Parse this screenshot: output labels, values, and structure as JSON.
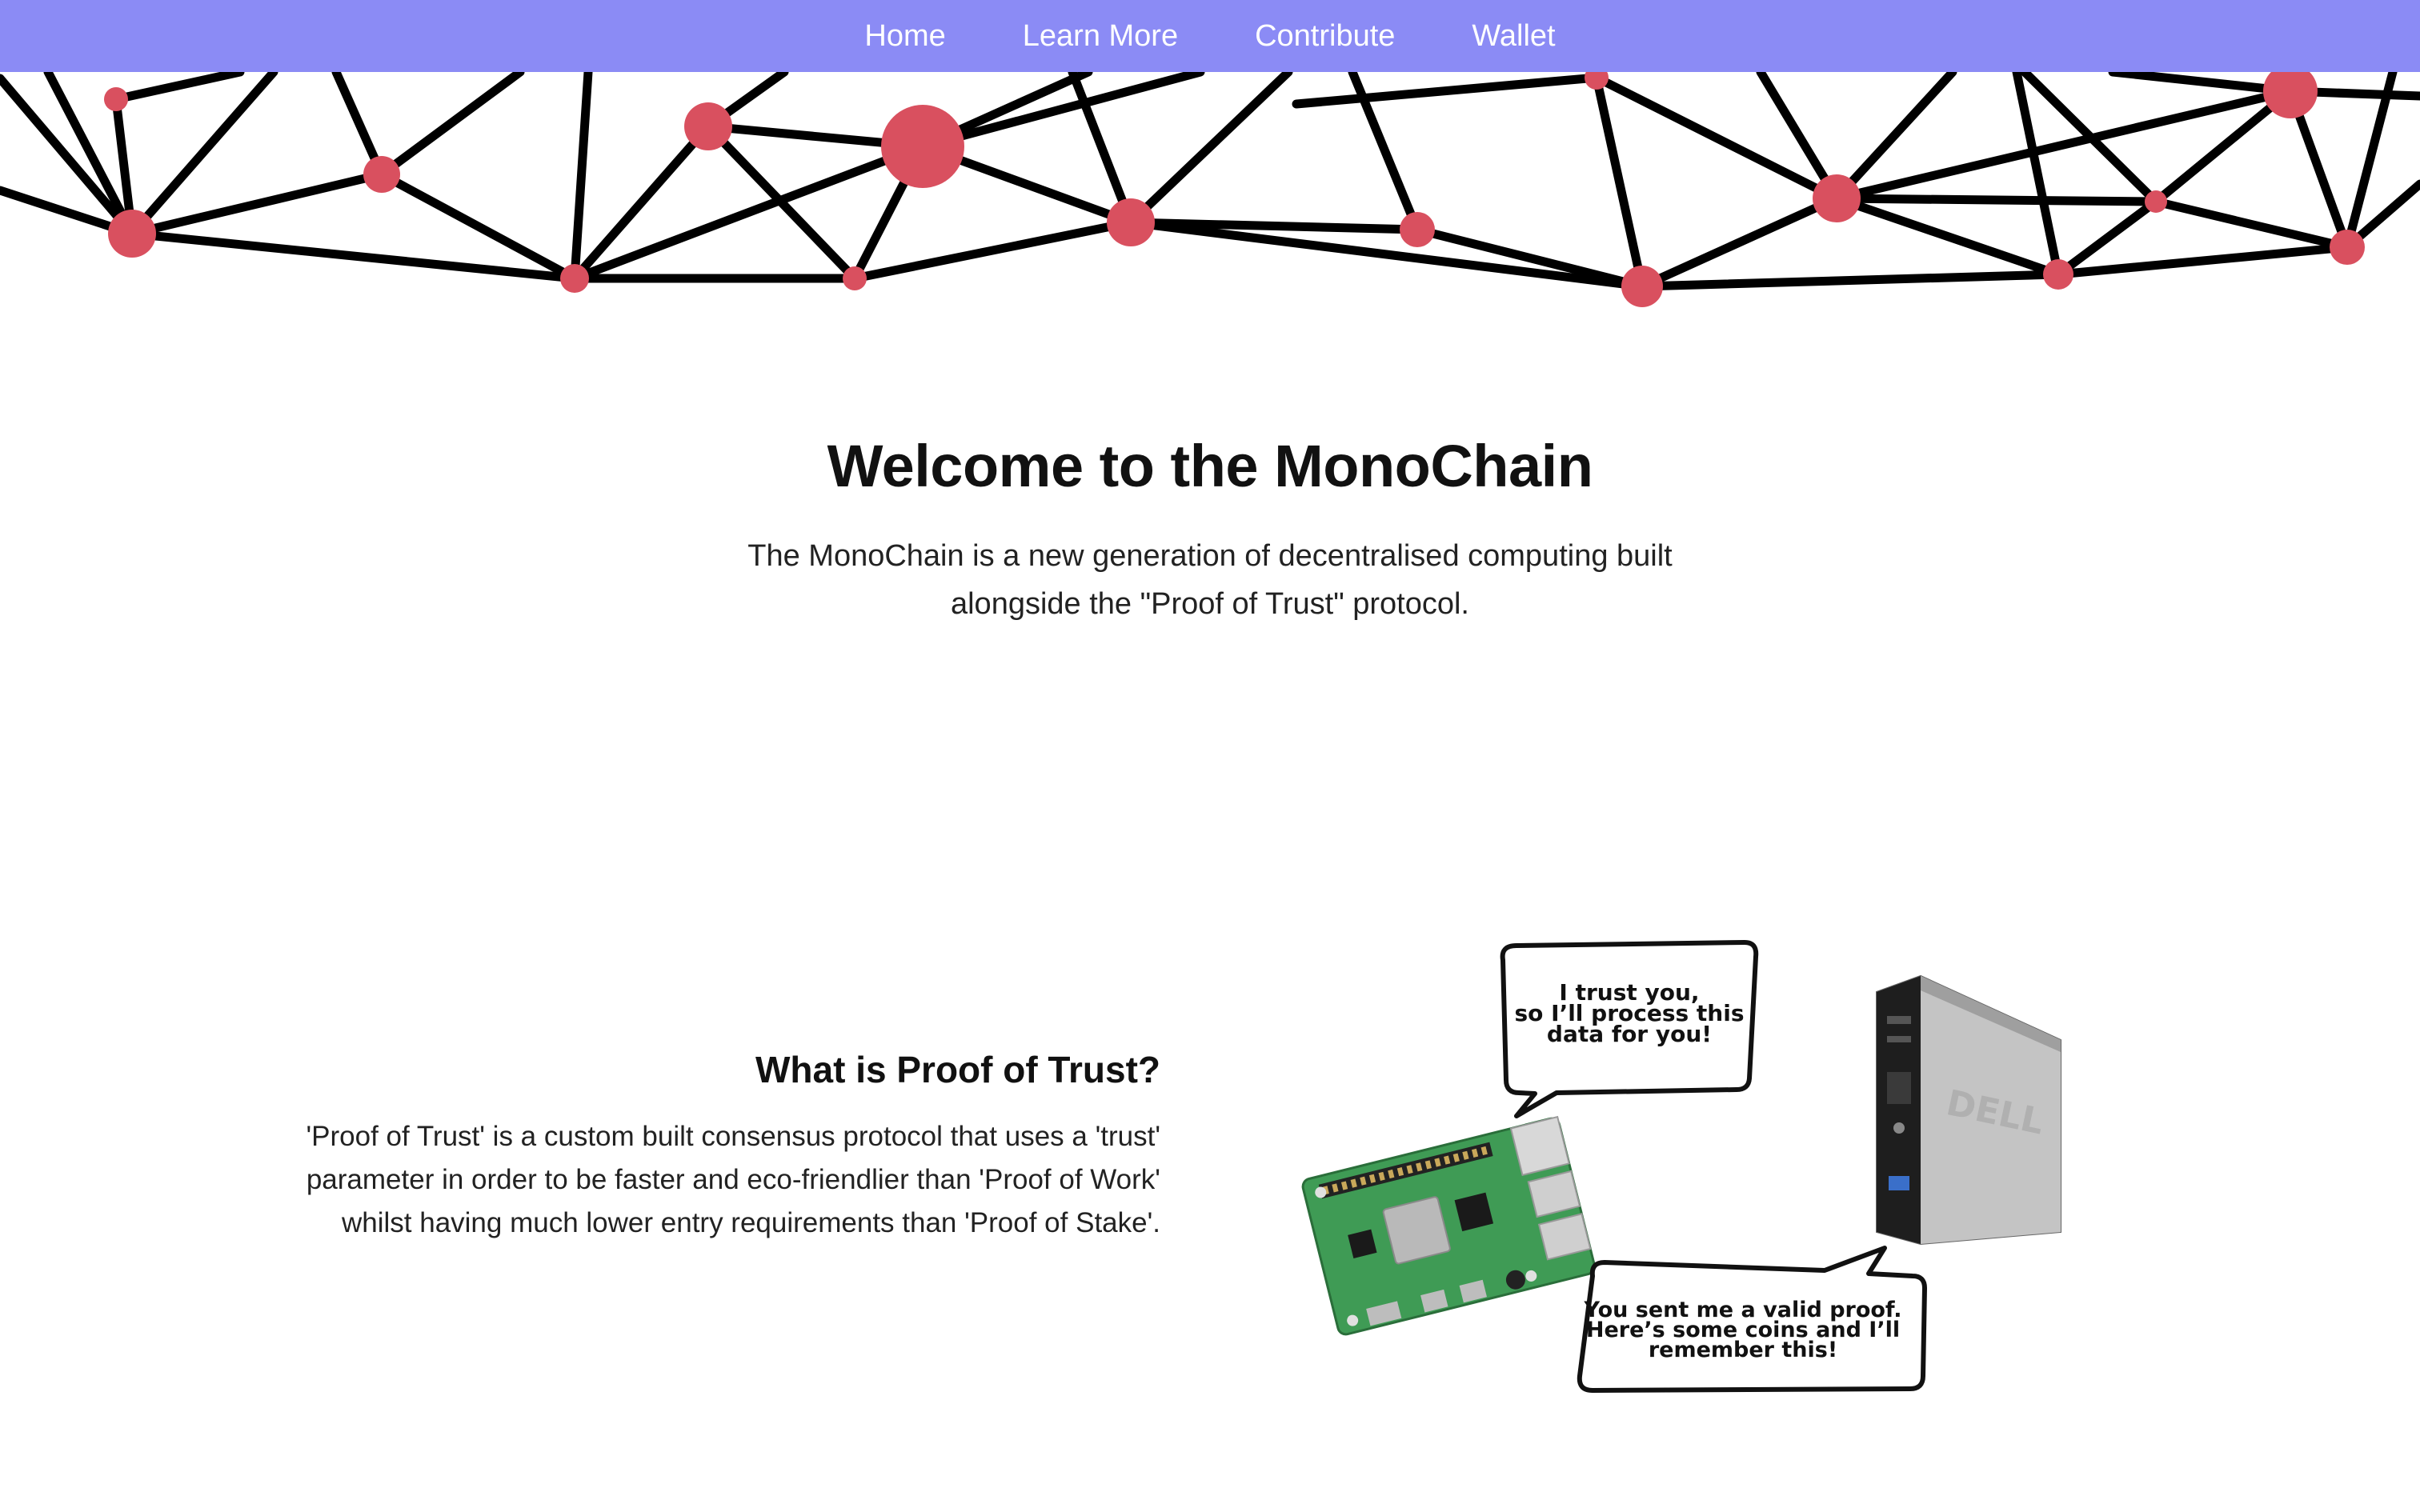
{
  "nav": {
    "items": [
      "Home",
      "Learn More",
      "Contribute",
      "Wallet"
    ]
  },
  "colors": {
    "nav_background": "#8b8bf5",
    "node": "#d9505f",
    "edge": "#000000"
  },
  "hero": {
    "title": "Welcome to the MonoChain",
    "description": "The MonoChain is a new generation of decentralised computing built alongside the \"Proof of Trust\" protocol."
  },
  "proof_of_trust": {
    "title": "What is Proof of Trust?",
    "description": "'Proof of Trust' is a custom built consensus protocol that uses a 'trust' parameter in order to be faster and eco-friendlier than 'Proof of Work' whilst having much lower entry requirements than 'Proof of Stake'."
  },
  "illustration": {
    "bubble_top_lines": [
      "I trust you,",
      "so I’ll process this",
      "data for you!"
    ],
    "bubble_bottom_lines": [
      "You sent me a valid proof.",
      "Here’s some coins and I’ll",
      "remember this!"
    ],
    "left_device": "raspberry-pi-board",
    "right_device": "desktop-tower-pc",
    "tower_brand": "DELL"
  }
}
